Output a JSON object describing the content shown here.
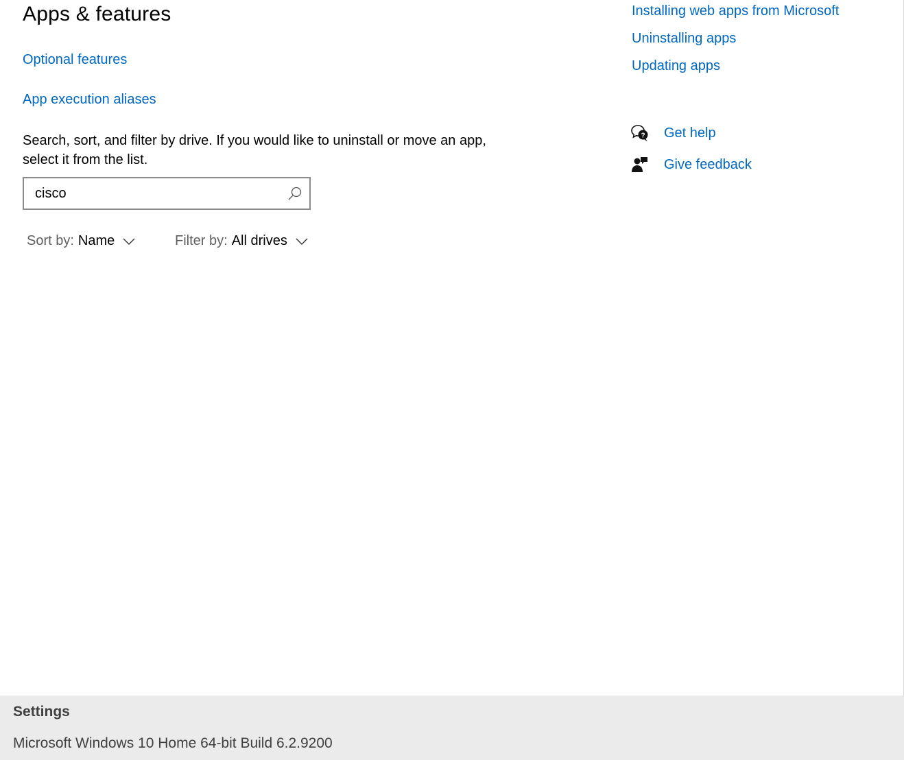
{
  "page": {
    "title": "Apps & features",
    "links": {
      "optional_features": "Optional features",
      "app_execution_aliases": "App execution aliases"
    },
    "description": "Search, sort, and filter by drive. If you would like to uninstall or move an app, select it from the list.",
    "search": {
      "value": "cisco",
      "icon": "search-icon"
    },
    "sort": {
      "label": "Sort by:",
      "value": "Name"
    },
    "filter": {
      "label": "Filter by:",
      "value": "All drives"
    }
  },
  "related": {
    "links": [
      "Installing web apps from Microsoft",
      "Uninstalling apps",
      "Updating apps"
    ],
    "get_help": "Get help",
    "give_feedback": "Give feedback"
  },
  "footer": {
    "title": "Settings",
    "subtitle": "Microsoft Windows 10 Home 64-bit Build 6.2.9200"
  },
  "colors": {
    "accent_link": "#0067c0",
    "footer_bg": "#ebebeb"
  }
}
